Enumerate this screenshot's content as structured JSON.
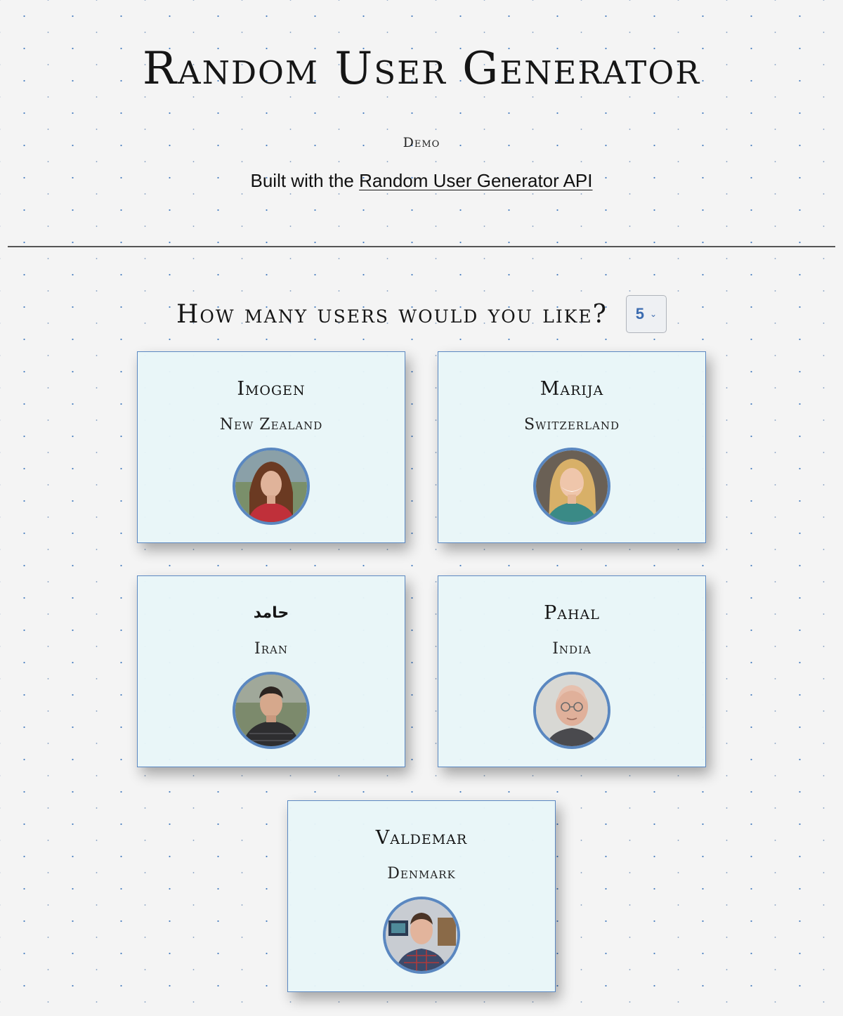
{
  "header": {
    "title": "Random User Generator",
    "demo_label": "Demo",
    "built_with_prefix": "Built with the",
    "api_link_text": "Random User Generator API"
  },
  "controls": {
    "question": "How many users would you like?",
    "selected_count": "5"
  },
  "users": [
    {
      "name": "Imogen",
      "country": "New Zealand",
      "avatar": "woman-long-hair-avatar"
    },
    {
      "name": "Marija",
      "country": "Switzerland",
      "avatar": "woman-blonde-avatar"
    },
    {
      "name": "حامد",
      "country": "Iran",
      "avatar": "man-dark-hair-jacket-avatar"
    },
    {
      "name": "Pahal",
      "country": "India",
      "avatar": "man-bald-glasses-avatar"
    },
    {
      "name": "Valdemar",
      "country": "Denmark",
      "avatar": "man-short-hair-office-avatar"
    }
  ],
  "colors": {
    "accent": "#5a87c0",
    "card_background": "#e8f6f8",
    "page_background": "#f4f4f4"
  }
}
